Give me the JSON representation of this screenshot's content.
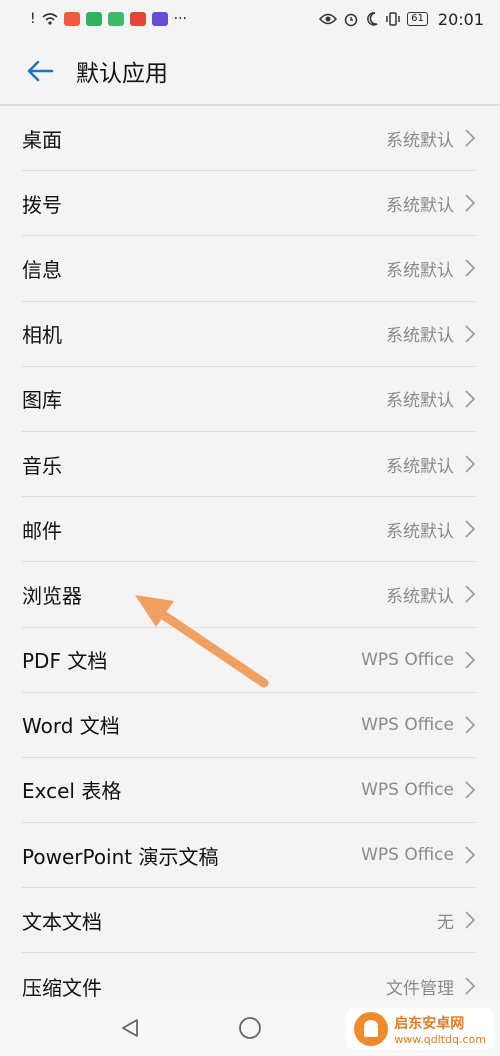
{
  "status_bar": {
    "time": "20:01",
    "battery": "61",
    "more": "···",
    "app_badge_colors": [
      "#f05a3a",
      "#2fb35f",
      "#3fb96a",
      "#e2433a",
      "#6b4ad6"
    ]
  },
  "header": {
    "title": "默认应用"
  },
  "items": [
    {
      "label": "桌面",
      "value": "系统默认"
    },
    {
      "label": "拨号",
      "value": "系统默认"
    },
    {
      "label": "信息",
      "value": "系统默认"
    },
    {
      "label": "相机",
      "value": "系统默认"
    },
    {
      "label": "图库",
      "value": "系统默认"
    },
    {
      "label": "音乐",
      "value": "系统默认"
    },
    {
      "label": "邮件",
      "value": "系统默认"
    },
    {
      "label": "浏览器",
      "value": "系统默认"
    },
    {
      "label": "PDF 文档",
      "value": "WPS Office"
    },
    {
      "label": "Word 文档",
      "value": "WPS Office"
    },
    {
      "label": "Excel 表格",
      "value": "WPS Office"
    },
    {
      "label": "PowerPoint 演示文稿",
      "value": "WPS Office"
    },
    {
      "label": "文本文档",
      "value": "无"
    },
    {
      "label": "压缩文件",
      "value": "文件管理"
    }
  ],
  "annotation": {
    "arrow_color": "#f0a060"
  },
  "watermark": {
    "title": "启东安卓网",
    "url": "www.qdltdq.com"
  }
}
